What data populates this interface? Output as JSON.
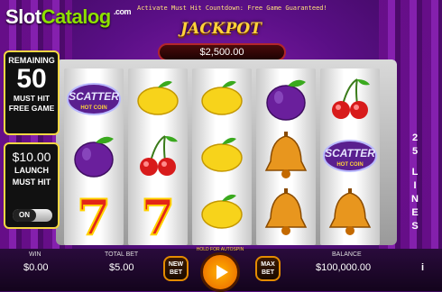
{
  "brand": {
    "part1": "Slot",
    "part2": "Catalog",
    "suffix": ".com"
  },
  "countdown_text": "Activate Must Hit Countdown: Free Game Guaranteed!",
  "jackpot": {
    "title": "JACKPOT",
    "amount": "$2,500.00"
  },
  "remaining_panel": {
    "label": "REMAINING",
    "count": "50",
    "line1": "MUST HIT",
    "line2": "FREE GAME"
  },
  "launch_panel": {
    "amount": "$10.00",
    "line1": "LAUNCH",
    "line2": "MUST HIT",
    "toggle_label": "ON"
  },
  "lines_label": "25 LINES",
  "lines_letters": [
    "2",
    "5",
    "",
    "L",
    "I",
    "N",
    "E",
    "S"
  ],
  "reels": [
    [
      "scatter",
      "plum",
      "seven"
    ],
    [
      "lemon",
      "cherry",
      "seven"
    ],
    [
      "lemon",
      "lemon",
      "lemon"
    ],
    [
      "plum",
      "bell",
      "bell"
    ],
    [
      "cherry",
      "scatter",
      "bell"
    ]
  ],
  "scatter_text": {
    "top": "SCATTER",
    "bottom": "HOT COIN"
  },
  "bottom_bar": {
    "win_label": "WIN",
    "win_value": "$0.00",
    "bet_label": "TOTAL BET",
    "bet_value": "$5.00",
    "new_bet": "NEW BET",
    "spin_hint": "HOLD FOR AUTOSPIN",
    "max_bet": "MAX BET",
    "balance_label": "BALANCE",
    "balance_value": "$100,000.00"
  },
  "colors": {
    "accent": "#f5d742",
    "logo_green": "#8ee000",
    "spin_orange": "#f07a00"
  }
}
